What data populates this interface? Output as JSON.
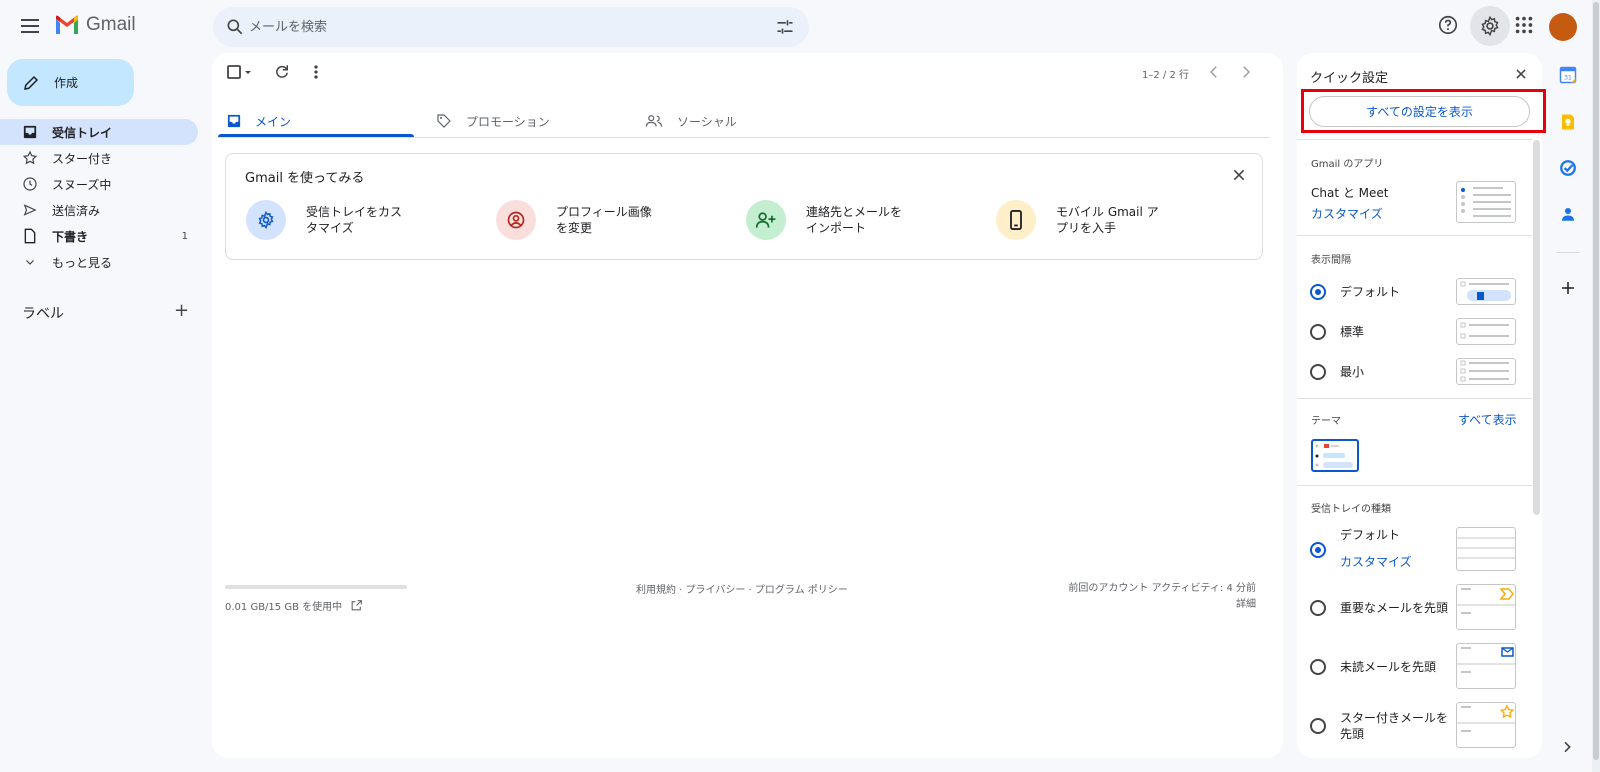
{
  "header": {
    "app_name": "Gmail",
    "search_placeholder": "メールを検索",
    "avatar_color": "#c55a11"
  },
  "sidebar": {
    "compose_label": "作成",
    "items": [
      {
        "label": "受信トレイ",
        "icon": "inbox-icon",
        "active": true
      },
      {
        "label": "スター付き",
        "icon": "star-icon"
      },
      {
        "label": "スヌーズ中",
        "icon": "clock-icon"
      },
      {
        "label": "送信済み",
        "icon": "send-icon"
      },
      {
        "label": "下書き",
        "icon": "draft-icon",
        "count": "1"
      },
      {
        "label": "もっと見る",
        "icon": "chevron-down-icon"
      }
    ],
    "labels_title": "ラベル"
  },
  "main": {
    "pager": "1–2 / 2 行",
    "tabs": [
      {
        "label": "メイン",
        "icon": "inbox-icon",
        "active": true
      },
      {
        "label": "プロモーション",
        "icon": "tag-icon"
      },
      {
        "label": "ソーシャル",
        "icon": "people-icon"
      }
    ],
    "get_started": {
      "title": "Gmail を使ってみる",
      "items": [
        {
          "line1": "受信トレイをカス",
          "line2": "タマイズ",
          "icon": "gear-icon",
          "color": "#d3e3fd"
        },
        {
          "line1": "プロフィール画像",
          "line2": "を変更",
          "icon": "account-circle-icon",
          "color": "#f9dedc"
        },
        {
          "line1": "連絡先とメールを",
          "line2": "インポート",
          "icon": "person-add-icon",
          "color": "#c4eed0"
        },
        {
          "line1": "モバイル Gmail ア",
          "line2": "プリを入手",
          "icon": "phone-icon",
          "color": "#ffefc9"
        }
      ]
    },
    "storage": "0.01 GB/15 GB を使用中",
    "footer_links": "利用規約 · プライバシー · プログラム ポリシー",
    "activity_line1": "前回のアカウント アクティビティ: 4 分前",
    "activity_line2": "詳細"
  },
  "quick_settings": {
    "title": "クイック設定",
    "all_settings_button": "すべての設定を表示",
    "apps_section": "Gmail のアプリ",
    "chat_meet": "Chat と Meet",
    "customize": "カスタマイズ",
    "density_section": "表示間隔",
    "density_options": [
      "デフォルト",
      "標準",
      "最小"
    ],
    "theme_section": "テーマ",
    "theme_view_all": "すべて表示",
    "inbox_type_section": "受信トレイの種類",
    "inbox_types": [
      {
        "label": "デフォルト",
        "sub": "カスタマイズ"
      },
      {
        "label": "重要なメールを先頭"
      },
      {
        "label": "未読メールを先頭"
      },
      {
        "label": "スター付きメールを",
        "label2": "先頭"
      }
    ],
    "accent_color": "#0b57d0",
    "highlight_color": "#e8000b"
  }
}
